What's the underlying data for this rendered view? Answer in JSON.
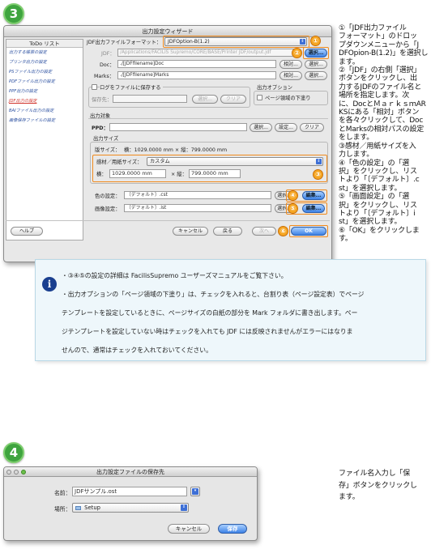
{
  "step3": {
    "badge": "3"
  },
  "dialog1": {
    "title": "出力設定ウィザード",
    "sidebar": {
      "header": "ToDo リスト",
      "items": [
        "出力する帳票の設定",
        "プリンタ出力の設定",
        "PSファイル出力の設定",
        "PDFファイル出力の設定",
        "PPF出力の設定",
        "JDF出力の設定",
        "BAIファイル出力の設定",
        "画像保存ファイルの設定"
      ],
      "active_index": 5
    },
    "format_label": "JDF出力ファイルフォーマット：",
    "format_value": "JDFOption-B(1.2)",
    "jdf_label": "JDF：",
    "jdf_value": "/Applications/FACILIS Supremo/CORE/BASE/Printer JDF/output.jdf",
    "select_button": "選択...",
    "doc_label": "Doc：",
    "doc_value": "./[JDFfilename]Doc",
    "relative_button": "相対...",
    "marks_label": "Marks：",
    "marks_value": "./[JDFfilename]Marks",
    "log_checkbox_label": "ログをファイルに保存する",
    "save_to_label": "保存先：",
    "clear_button": "クリア",
    "output_option_title": "出力オプション",
    "page_fill_label": "ページ領域の下塗り",
    "output_target_title": "出力対象",
    "ppd_label": "PPD：",
    "settings_button": "設定...",
    "output_size_title": "出力サイズ",
    "plate_size_label": "版サイズ：",
    "plate_size_value": "横：1029.0000 mm × 縦：799.0000 mm",
    "media_size_label": "感材／用紙サイズ：",
    "media_size_value": "カスタム",
    "width_label": "横：",
    "width_value": "1029.0000 mm",
    "height_label": "× 縦：",
    "height_value": "799.0000 mm",
    "color_setting_label": "色の設定：",
    "color_setting_value": "〔デフォルト〕.cst",
    "image_setting_label": "画像設定：",
    "image_setting_value": "〔デフォルト〕.ist",
    "edit_button": "編集...",
    "help_button": "ヘルプ",
    "cancel_button": "キャンセル",
    "back_button": "戻る",
    "next_button": "次へ",
    "ok_button": "OK",
    "markers": [
      "①",
      "②",
      "③",
      "④",
      "⑤",
      "⑥"
    ]
  },
  "step3_note": "①「JDF出力ファイル\nフォーマット」のドロッ\nプダウンメニューから「J\nDFOpion-B(1.2)」を選択し\nます。\n②「JDF」の右側「選択」\nボタンをクリックし、出\n力するJDFのファイル名と\n場所を指定します。次\nに、DocとＭａｒｋｓｍAR\nKSにある「相対」ボタン\nを各々クリックして、Doc\nとMarksの相対パスの設定\nをします。\n③感材／用紙サイズを入\n力します。\n④「色の設定」の「選\n択」をクリックし、リス\nトより「〔デフォルト〕.c\nst」を選択します。\n⑤「画面設定」の「選\n択」をクリックし、リス\nトより「〔デフォルト〕i\nst」を選択します。\n⑥「OK」をクリックしま\nす。",
  "info": {
    "line1": "・③④⑤の設定の詳細は FacilisSupremo ユーザーズマニュアルをご覧下さい。",
    "line2": "・出力オプションの「ページ領域の下塗り」は、チェックを入れると、台割り表（ページ設定表）でページ",
    "line3": "テンプレートを設定しているときに、ページサイズの白紙の部分を Mark フォルダに書き出します。ペー",
    "line4": "ジテンプレートを設定していない時はチェックを入れても JDF には反映されませんがエラーにはなりま",
    "line5": "せんので、通常はチェックを入れておいてください。"
  },
  "step4": {
    "badge": "4"
  },
  "dialog2": {
    "title": "出力設定ファイルの保存先",
    "name_label": "名前：",
    "name_value": "JDFサンプル.ost",
    "location_label": "場所：",
    "location_value": "Setup",
    "cancel_button": "キャンセル",
    "save_button": "保存"
  },
  "step4_note": "ファイル名入力し「保\n存」ボタンをクリックし\nます。"
}
